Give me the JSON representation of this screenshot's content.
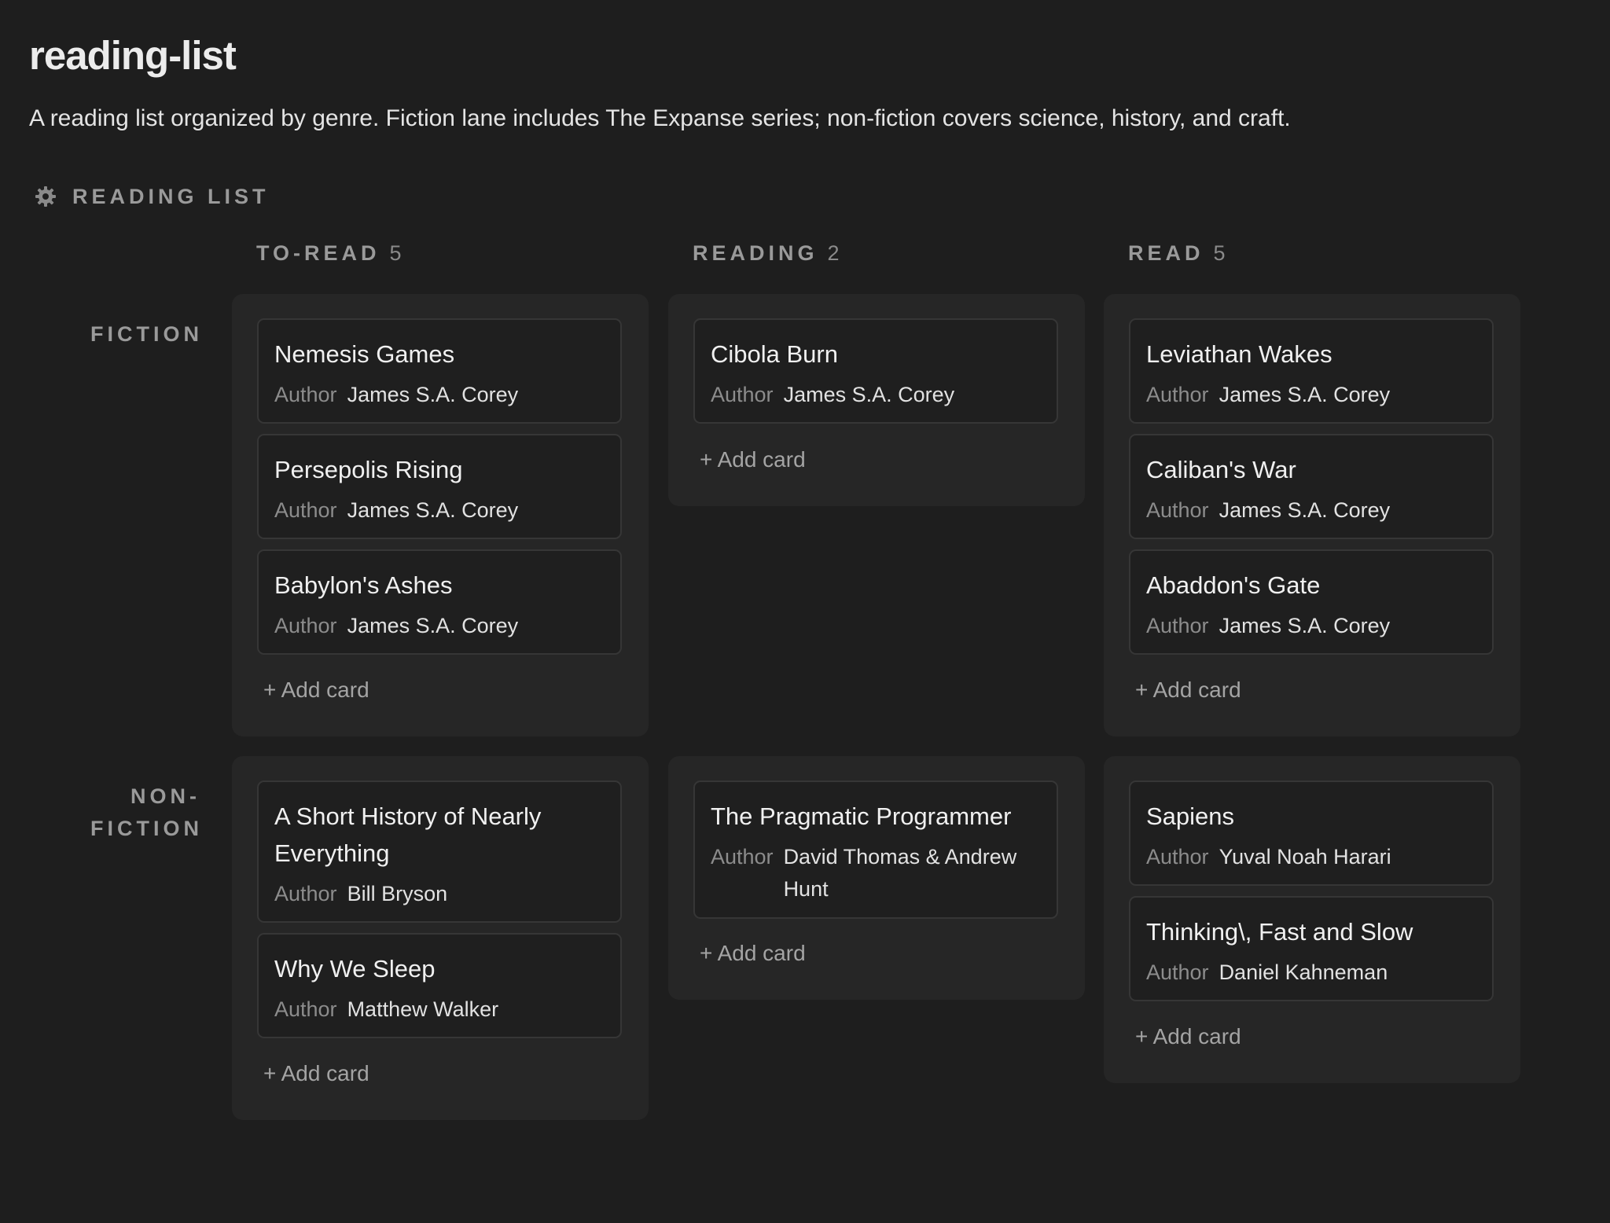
{
  "page": {
    "title": "reading-list",
    "description": "A reading list organized by genre. Fiction lane includes The Expanse series; non-fiction covers science, history, and craft."
  },
  "board": {
    "title": "READING LIST",
    "icon": "gear-icon"
  },
  "columns": [
    {
      "name": "TO-READ",
      "count": "5"
    },
    {
      "name": "READING",
      "count": "2"
    },
    {
      "name": "READ",
      "count": "5"
    }
  ],
  "rows": [
    {
      "label_line1": "FICTION",
      "label_line2": ""
    },
    {
      "label_line1": "NON-",
      "label_line2": "FICTION"
    }
  ],
  "property_label": "Author",
  "add_card_label": "+ Add card",
  "cells": {
    "fiction_to_read": [
      {
        "title": "Nemesis Games",
        "author": "James S.A. Corey"
      },
      {
        "title": "Persepolis Rising",
        "author": "James S.A. Corey"
      },
      {
        "title": "Babylon's Ashes",
        "author": "James S.A. Corey"
      }
    ],
    "fiction_reading": [
      {
        "title": "Cibola Burn",
        "author": "James S.A. Corey"
      }
    ],
    "fiction_read": [
      {
        "title": "Leviathan Wakes",
        "author": "James S.A. Corey"
      },
      {
        "title": "Caliban's War",
        "author": "James S.A. Corey"
      },
      {
        "title": "Abaddon's Gate",
        "author": "James S.A. Corey"
      }
    ],
    "nonfiction_to_read": [
      {
        "title": "A Short History of Nearly Everything",
        "author": "Bill Bryson"
      },
      {
        "title": "Why We Sleep",
        "author": "Matthew Walker"
      }
    ],
    "nonfiction_reading": [
      {
        "title": "The Pragmatic Programmer",
        "author": "David Thomas & Andrew Hunt"
      }
    ],
    "nonfiction_read": [
      {
        "title": "Sapiens",
        "author": "Yuval Noah Harari"
      },
      {
        "title": "Thinking\\, Fast and Slow",
        "author": "Daniel Kahneman"
      }
    ]
  }
}
